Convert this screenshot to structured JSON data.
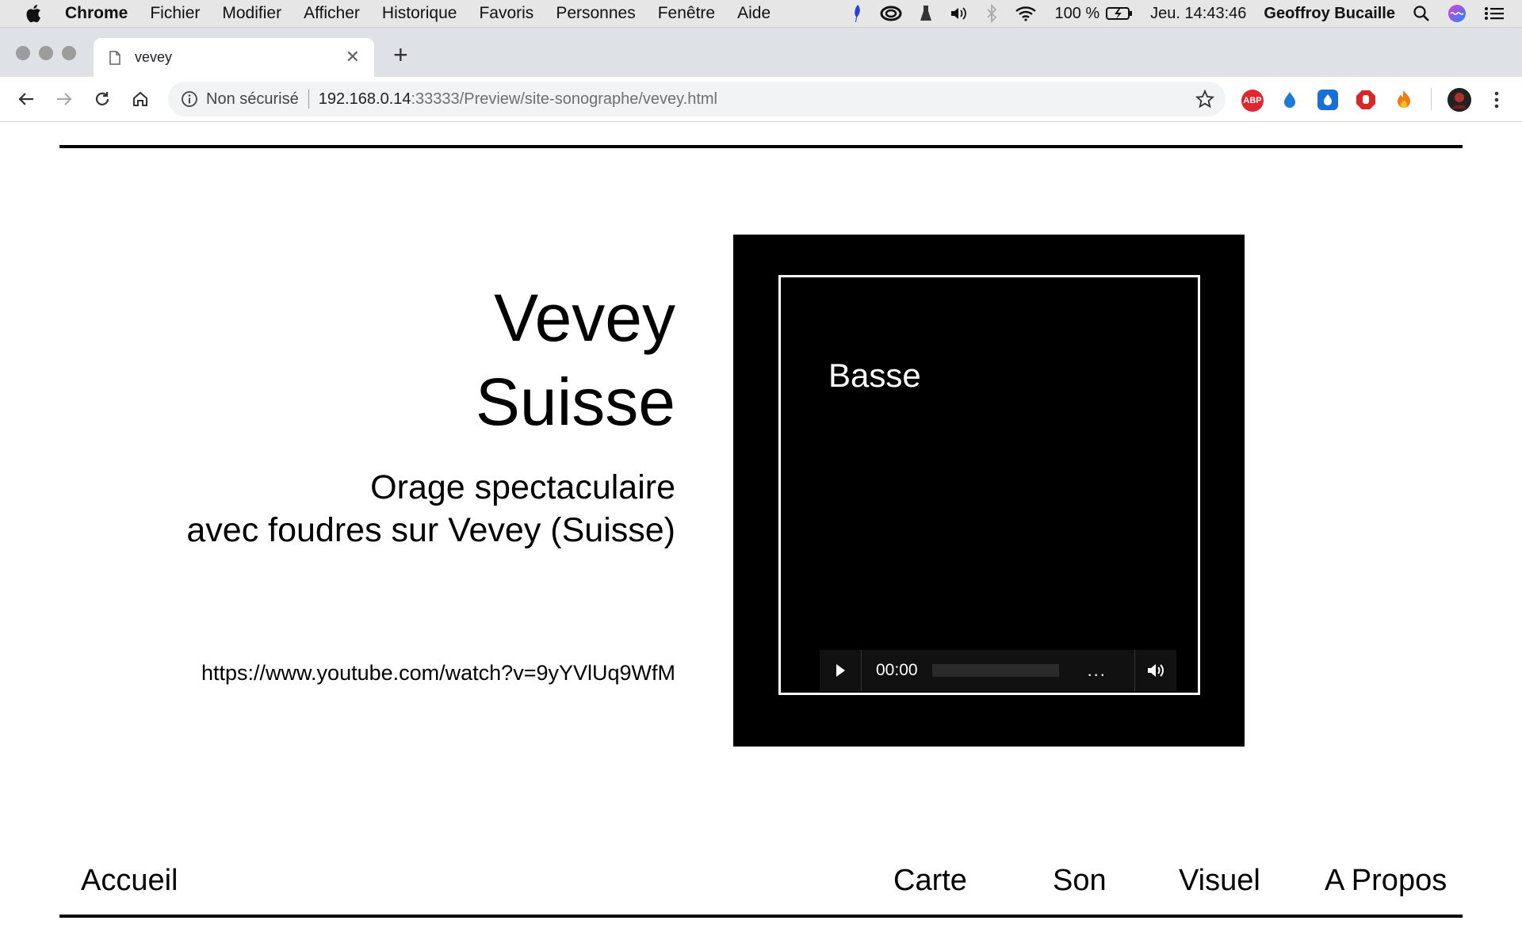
{
  "menubar": {
    "app_name": "Chrome",
    "items": [
      "Fichier",
      "Modifier",
      "Afficher",
      "Historique",
      "Favoris",
      "Personnes",
      "Fenêtre",
      "Aide"
    ],
    "battery": "100 %",
    "clock": "Jeu. 14:43:46",
    "user": "Geoffroy Bucaille"
  },
  "tab": {
    "title": "vevey"
  },
  "toolbar": {
    "security_label": "Non sécurisé",
    "url_host": "192.168.0.14",
    "url_path": ":33333/Preview/site-sonographe/vevey.html"
  },
  "page": {
    "title_line1": "Vevey",
    "title_line2": "Suisse",
    "subtitle_line1": "Orage spectaculaire",
    "subtitle_line2": "avec foudres sur Vevey (Suisse)",
    "source_link": "https://www.youtube.com/watch?v=9yYVlUq9WfM"
  },
  "player": {
    "label": "Basse",
    "time": "00:00",
    "more": "..."
  },
  "footer_nav": {
    "home": "Accueil",
    "map": "Carte",
    "sound": "Son",
    "visual": "Visuel",
    "about": "A Propos"
  }
}
